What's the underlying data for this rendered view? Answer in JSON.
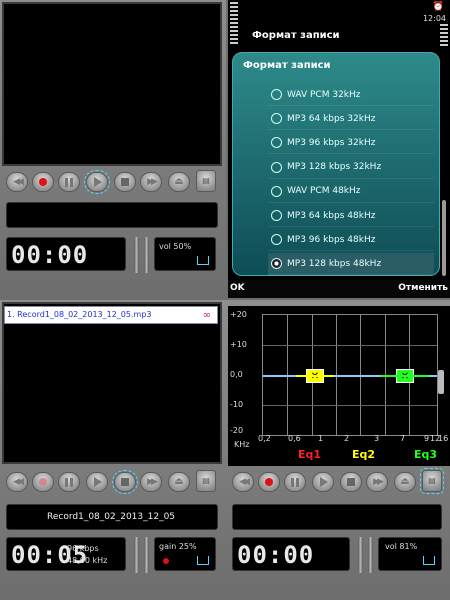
{
  "status_bar": {
    "time": "12:04"
  },
  "dialog": {
    "title": "Формат записи",
    "header": "Формат записи",
    "options": [
      {
        "label": "WAV PCM 32kHz",
        "selected": false
      },
      {
        "label": "MP3 64 kbps 32kHz",
        "selected": false
      },
      {
        "label": "MP3 96 kbps 32kHz",
        "selected": false
      },
      {
        "label": "MP3 128 kbps 32kHz",
        "selected": false
      },
      {
        "label": "WAV PCM 48kHz",
        "selected": false
      },
      {
        "label": "MP3 64 kbps 48kHz",
        "selected": false
      },
      {
        "label": "MP3 96 kbps 48kHz",
        "selected": false
      },
      {
        "label": "MP3 128 kbps 48kHz",
        "selected": true
      }
    ],
    "ok_label": "OK",
    "cancel_label": "Отменить"
  },
  "player_top": {
    "time": "00:00",
    "vol": "vol 50%"
  },
  "recorder": {
    "file_item": "1. Record1_08_02_2013_12_05.mp3",
    "filename": "Record1_08_02_2013_12_05",
    "time": "00:05",
    "bitrate": "96 kbps",
    "rate": "48,00 kHz",
    "gain": "gain 25%"
  },
  "player_right": {
    "time": "00:00",
    "vol": "vol 81%"
  },
  "equalizer": {
    "y_ticks": [
      "+20",
      "+10",
      "0,0",
      "-10",
      "-20"
    ],
    "x_unit": "KHz",
    "x_ticks": [
      "0,2",
      "0,6",
      "1",
      "2",
      "3",
      "7",
      "9",
      "12",
      "16"
    ],
    "bands": [
      "Eq1",
      "Eq2",
      "Eq3"
    ],
    "colors": {
      "Eq1": "#ff2020",
      "Eq2": "#ffff00",
      "Eq3": "#20ff20"
    }
  }
}
